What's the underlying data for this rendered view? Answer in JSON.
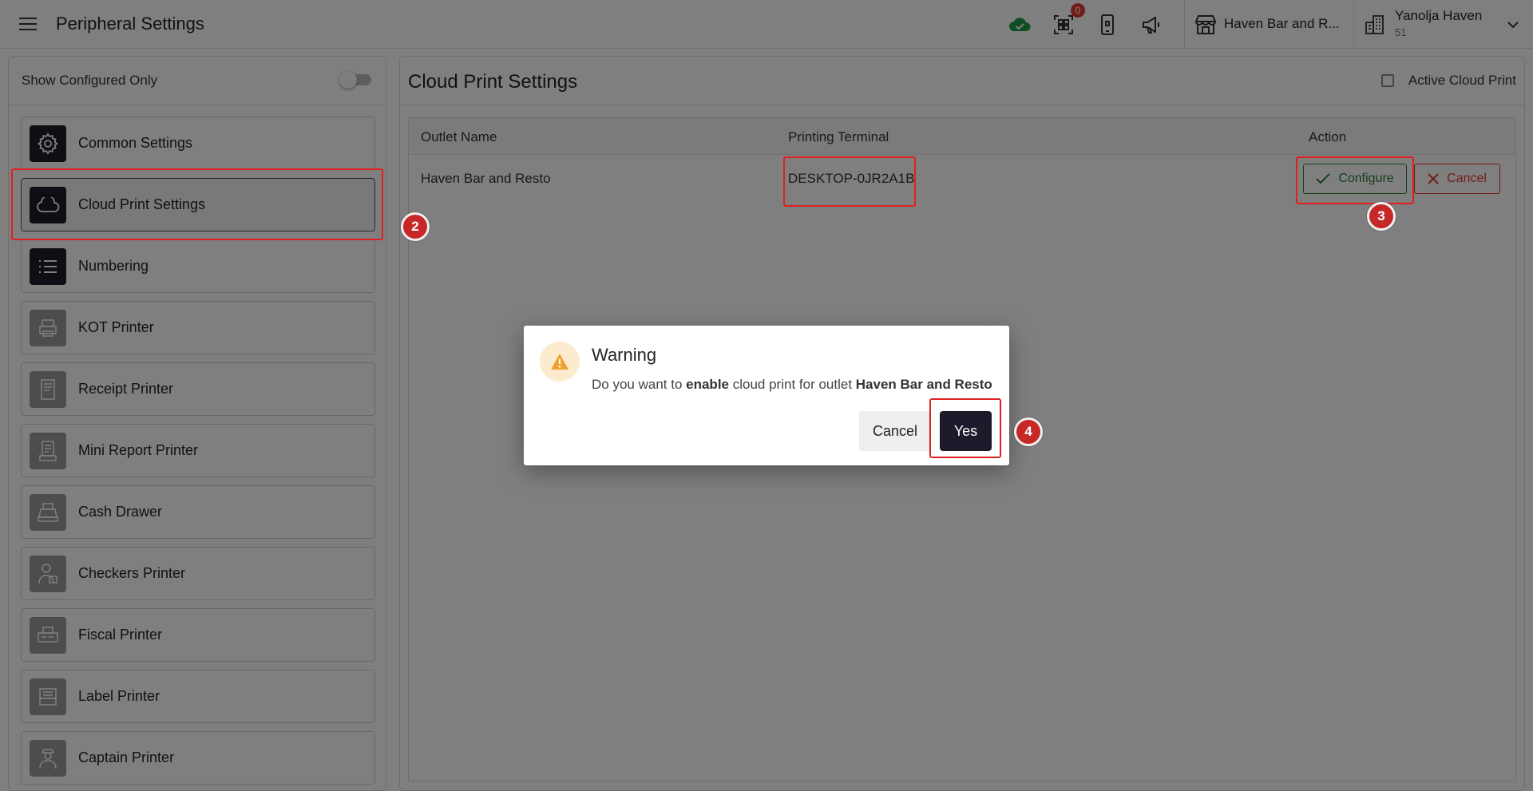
{
  "header": {
    "title": "Peripheral Settings",
    "notification_count": "0",
    "outlet": "Haven Bar and R...",
    "user": {
      "name": "Yanolja Haven",
      "id": "51"
    }
  },
  "sidebar": {
    "filter_label": "Show Configured Only",
    "items": [
      {
        "label": "Common Settings",
        "icon": "gear-icon"
      },
      {
        "label": "Cloud Print Settings",
        "icon": "cloud-icon"
      },
      {
        "label": "Numbering",
        "icon": "list-icon"
      },
      {
        "label": "KOT Printer",
        "icon": "kot-printer-icon"
      },
      {
        "label": "Receipt Printer",
        "icon": "receipt-icon"
      },
      {
        "label": "Mini Report Printer",
        "icon": "mini-report-icon"
      },
      {
        "label": "Cash Drawer",
        "icon": "cash-register-icon"
      },
      {
        "label": "Checkers Printer",
        "icon": "checker-person-icon"
      },
      {
        "label": "Fiscal Printer",
        "icon": "fiscal-printer-icon"
      },
      {
        "label": "Label Printer",
        "icon": "label-printer-icon"
      },
      {
        "label": "Captain Printer",
        "icon": "captain-icon"
      }
    ]
  },
  "main": {
    "title": "Cloud Print Settings",
    "active_label": "Active Cloud Print",
    "table": {
      "headers": [
        "Outlet Name",
        "Printing Terminal",
        "Action"
      ],
      "rows": [
        {
          "outlet": "Haven Bar and Resto",
          "terminal": "DESKTOP-0JR2A1B",
          "configure": "Configure",
          "cancel": "Cancel"
        }
      ]
    }
  },
  "dialog": {
    "title": "Warning",
    "msg_prefix": "Do you want to",
    "msg_bold1": "enable",
    "msg_mid": "cloud print for outlet",
    "msg_bold2": "Haven Bar and Resto",
    "cancel_label": "Cancel",
    "yes_label": "Yes"
  },
  "annotations": {
    "step2": "2",
    "step3": "3",
    "step4": "4"
  },
  "colors": {
    "accent_dark": "#1d1a2c",
    "success": "#2e7d32",
    "danger": "#e53935",
    "annotation": "#c62828"
  }
}
